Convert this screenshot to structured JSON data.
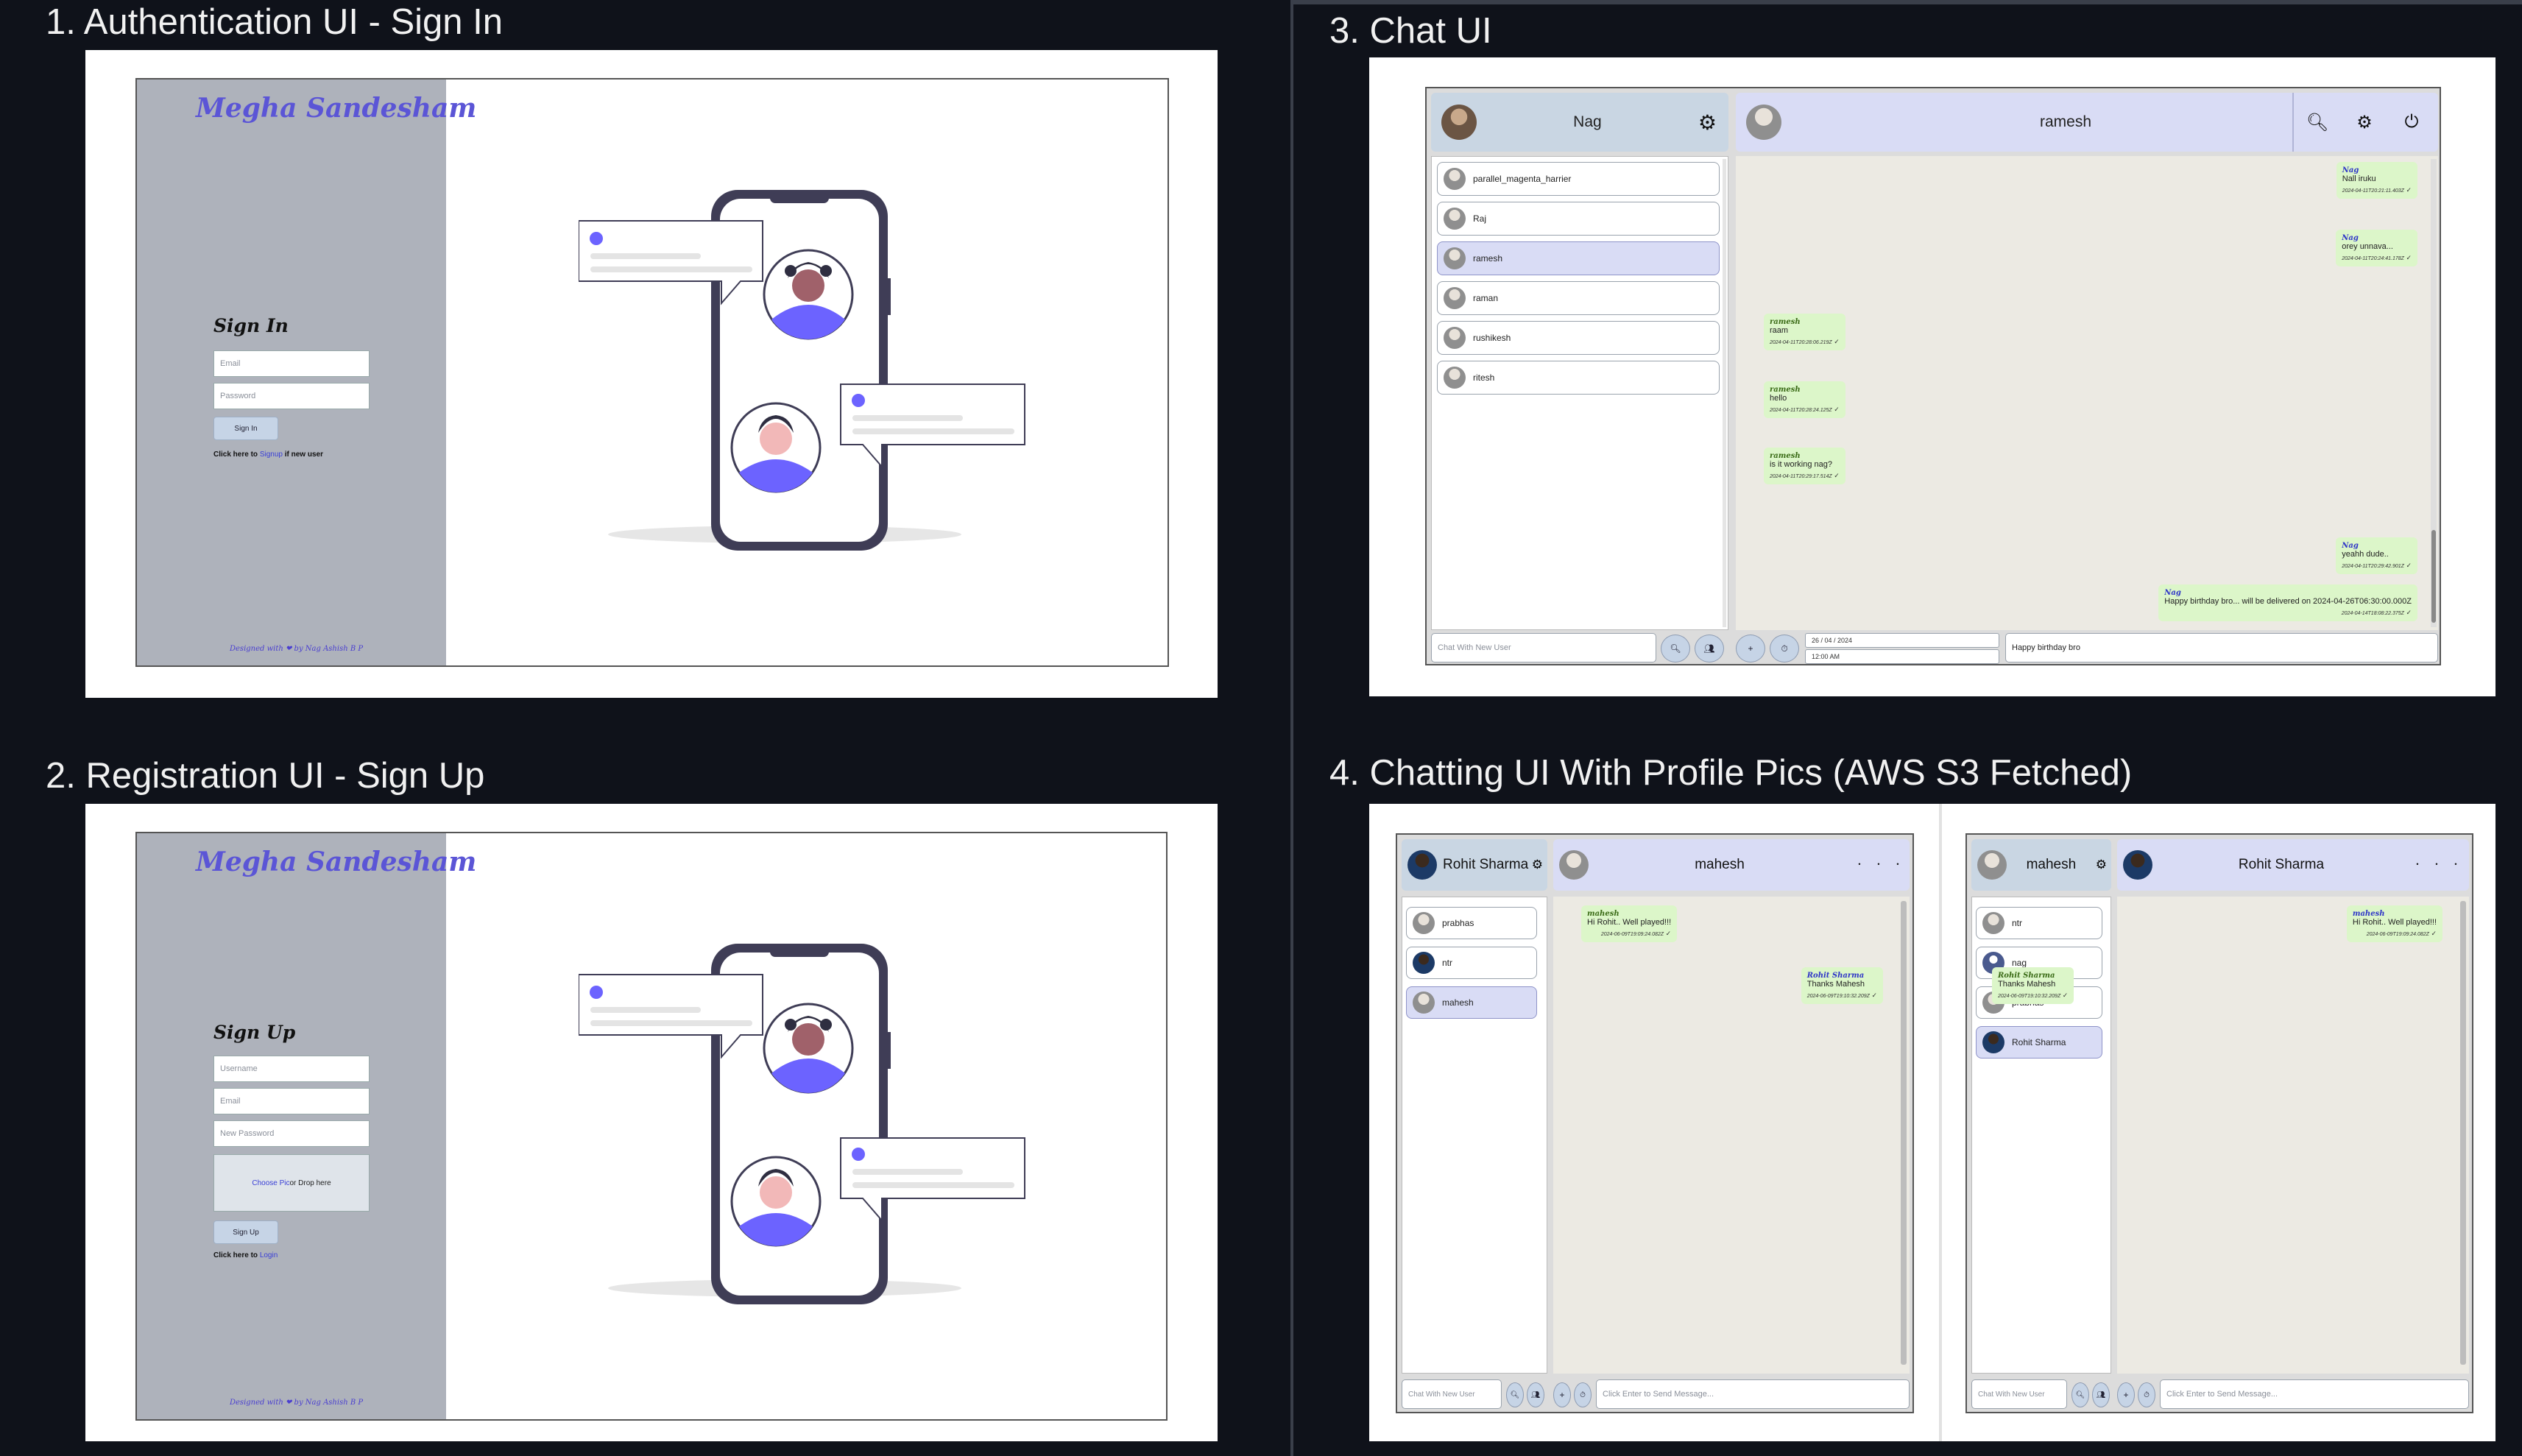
{
  "sections": {
    "s1": "1. Authentication UI - Sign In",
    "s2": "2. Registration UI - Sign Up",
    "s3": "3. Chat UI",
    "s4": "4. Chatting UI With Profile Pics (AWS S3 Fetched)"
  },
  "signin": {
    "brand": "Megha Sandesham",
    "title": "Sign In",
    "email_placeholder": "Email",
    "password_placeholder": "Password",
    "button": "Sign In",
    "prompt_prefix": "Click here to ",
    "prompt_link": "Signup",
    "prompt_suffix": " if new user",
    "footer": "Designed with ❤ by Nag Ashish B P"
  },
  "signup": {
    "brand": "Megha Sandesham",
    "title": "Sign Up",
    "username_placeholder": "Username",
    "email_placeholder": "Email",
    "password_placeholder": "New Password",
    "drop_link": "Choose Pic",
    "drop_text": " or Drop here",
    "button": "Sign Up",
    "prompt_prefix": "Click here to ",
    "prompt_link": "Login",
    "footer": "Designed with ❤ by Nag Ashish B P"
  },
  "chat": {
    "me": "Nag",
    "partner": "ramesh",
    "contacts": [
      "parallel_magenta_harrier",
      "Raj",
      "ramesh",
      "raman",
      "rushikesh",
      "ritesh"
    ],
    "selected_index": 2,
    "new_user_placeholder": "Chat With New User",
    "date_value": "26 / 04 / 2024",
    "time_value": "12:00 AM",
    "message_value": "Happy birthday bro",
    "messages": [
      {
        "from": "Nag",
        "text": "Nall iruku",
        "time": "2024-04-11T20:21:11.403Z",
        "side": "right"
      },
      {
        "from": "Nag",
        "text": "orey unnava...",
        "time": "2024-04-11T20:24:41.178Z",
        "side": "right"
      },
      {
        "from": "ramesh",
        "text": "raam",
        "time": "2024-04-11T20:28:06.219Z",
        "side": "left"
      },
      {
        "from": "ramesh",
        "text": "hello",
        "time": "2024-04-11T20:28:24.125Z",
        "side": "left"
      },
      {
        "from": "ramesh",
        "text": "is it working nag?",
        "time": "2024-04-11T20:29:17.514Z",
        "side": "left"
      },
      {
        "from": "Nag",
        "text": "yeahh dude..",
        "time": "2024-04-11T20:29:42.901Z",
        "side": "right"
      },
      {
        "from": "Nag",
        "text": "Happy birthday bro... will be delivered on 2024-04-26T06:30:00.000Z",
        "time": "2024-04-14T18:08:22.375Z",
        "side": "right"
      }
    ]
  },
  "profile_left": {
    "me": "Rohit Sharma",
    "partner": "mahesh",
    "contacts": [
      "prabhas",
      "ntr",
      "mahesh"
    ],
    "selected_index": 2,
    "new_user_placeholder": "Chat With New User",
    "message_placeholder": "Click Enter to Send Message...",
    "messages": [
      {
        "from": "mahesh",
        "text": "Hi Rohit.. Well played!!!",
        "time": "2024-06-09T19:09:24.082Z",
        "side": "left"
      },
      {
        "from": "Rohit Sharma",
        "text": "Thanks Mahesh",
        "time": "2024-06-09T19:10:32.209Z",
        "side": "right"
      }
    ]
  },
  "profile_right": {
    "me": "mahesh",
    "partner": "Rohit Sharma",
    "contacts": [
      "ntr",
      "nag",
      "prabhas",
      "Rohit Sharma"
    ],
    "selected_index": 3,
    "new_user_placeholder": "Chat With New User",
    "message_placeholder": "Click Enter to Send Message...",
    "messages": [
      {
        "from": "mahesh",
        "text": "Hi Rohit.. Well played!!!",
        "time": "2024-06-09T19:09:24.082Z",
        "side": "right"
      },
      {
        "from": "Rohit Sharma",
        "text": "Thanks Mahesh",
        "time": "2024-06-09T19:10:32.209Z",
        "side": "left"
      }
    ]
  },
  "colors": {
    "background": "#0f121a",
    "auth_sidebar": "#aeb2bb",
    "brand": "#5b55d6",
    "header_me": "#c9d6e3",
    "header_partner": "#d9dcf5",
    "bubble": "#dcf6c9",
    "chat_bg": "#eceae3"
  }
}
